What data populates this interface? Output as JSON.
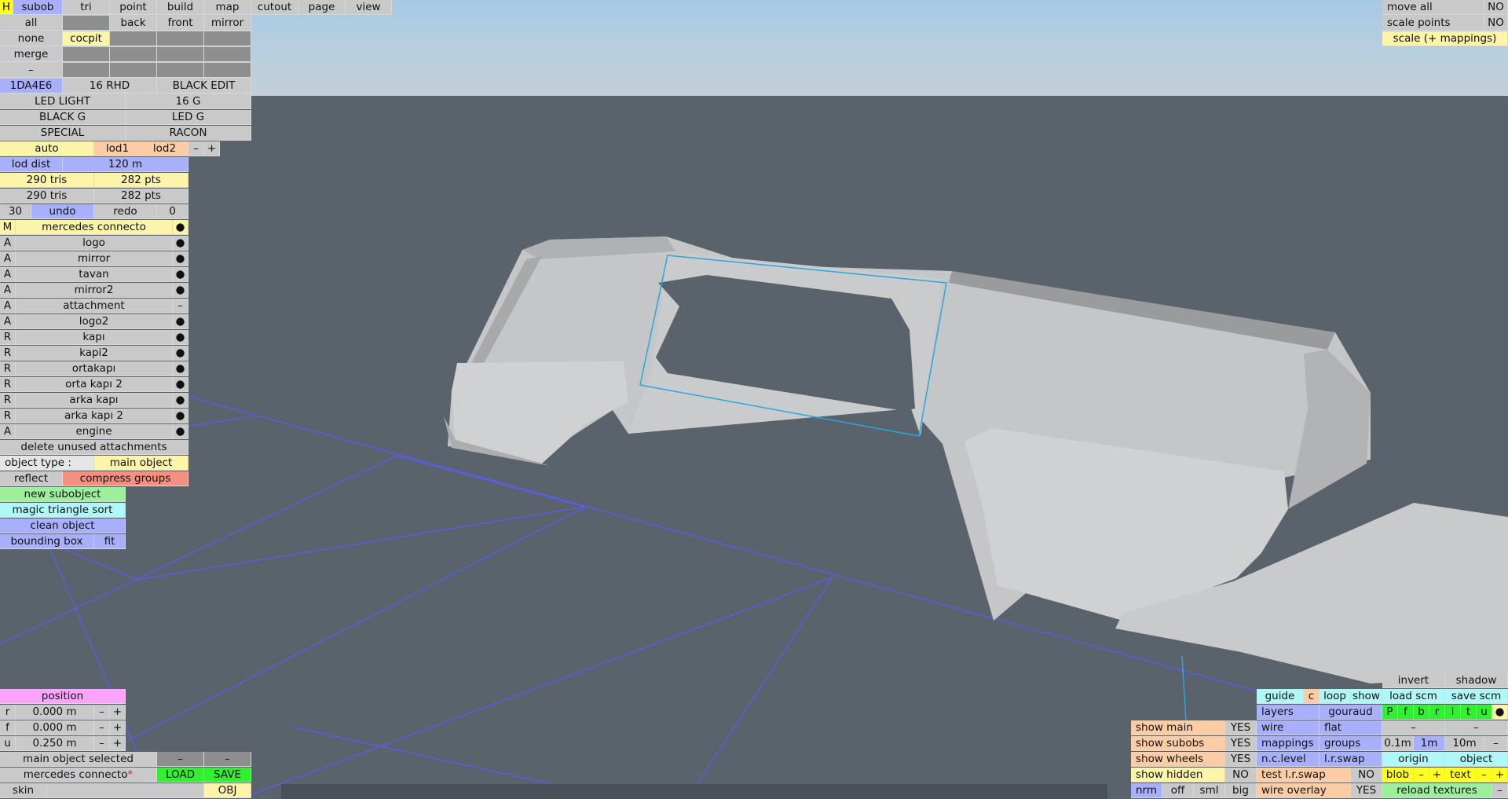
{
  "colors": {
    "sky_top": "#a7c9e4",
    "floor": "#5a626b",
    "grid": "#5a5cf0",
    "selection": "#2aa6e0",
    "model": "#c4c5c6"
  },
  "top_menu": {
    "h": "H",
    "items": [
      "subob",
      "tri",
      "point",
      "build",
      "map",
      "cutout",
      "page",
      "view"
    ]
  },
  "view_rows": {
    "all": "all",
    "back": "back",
    "front": "front",
    "mirror": "mirror",
    "none": "none",
    "cocpit": "cocpit",
    "merge": "merge",
    "dash": "–"
  },
  "mat_buttons": {
    "a": "1DA4E6",
    "b": "16 RHD",
    "c": "BLACK EDIT",
    "d": "LED LIGHT",
    "e": "16 G",
    "f": "BLACK G",
    "g": "LED G",
    "h": "SPECIAL",
    "i": "RACON"
  },
  "lod": {
    "auto": "auto",
    "lod1": "lod1",
    "lod2": "lod2",
    "minus": "–",
    "plus": "+",
    "dist_label": "lod dist",
    "dist_value": "120 m"
  },
  "stats": {
    "tris1": "290 tris",
    "pts1": "282 pts",
    "tris2": "290 tris",
    "pts2": "282 pts"
  },
  "undo": {
    "count": "30",
    "undo": "undo",
    "redo": "redo",
    "redo_count": "0"
  },
  "objects": {
    "root": {
      "tag": "M",
      "name": "mercedes connecto",
      "dot": "●"
    },
    "items": [
      {
        "tag": "A",
        "name": "logo",
        "dot": "●"
      },
      {
        "tag": "A",
        "name": "mirror",
        "dot": "●"
      },
      {
        "tag": "A",
        "name": "tavan",
        "dot": "●"
      },
      {
        "tag": "A",
        "name": "mirror2",
        "dot": "●"
      },
      {
        "tag": "A",
        "name": "attachment",
        "dot": "–"
      },
      {
        "tag": "A",
        "name": "logo2",
        "dot": "●"
      },
      {
        "tag": "R",
        "name": "kapı",
        "dot": "●"
      },
      {
        "tag": "R",
        "name": "kapi2",
        "dot": "●"
      },
      {
        "tag": "R",
        "name": "ortakapı",
        "dot": "●"
      },
      {
        "tag": "R",
        "name": "orta kapı 2",
        "dot": "●"
      },
      {
        "tag": "R",
        "name": "arka kapı",
        "dot": "●"
      },
      {
        "tag": "R",
        "name": "arka kapı 2",
        "dot": "●"
      },
      {
        "tag": "A",
        "name": "engine",
        "dot": "●"
      }
    ]
  },
  "actions": {
    "delete_unused": "delete unused attachments",
    "object_type_label": "object type :",
    "object_type_value": "main object",
    "reflect": "reflect",
    "compress": "compress groups",
    "new_subobject": "new subobject",
    "magic_sort": "magic triangle sort",
    "clean": "clean object",
    "bbox": "bounding box",
    "fit": "fit"
  },
  "position": {
    "title": "position",
    "rows": [
      {
        "axis": "r",
        "value": "0.000 m"
      },
      {
        "axis": "f",
        "value": "0.000 m"
      },
      {
        "axis": "u",
        "value": "0.250 m"
      }
    ],
    "minus": "–",
    "plus": "+"
  },
  "status": {
    "selected": "main object selected",
    "dash": "–",
    "file": "mercedes connecto",
    "asterisk": "*",
    "load": "LOAD",
    "save": "SAVE",
    "skin": "skin",
    "obj": "OBJ"
  },
  "top_right": {
    "move_all": "move all",
    "move_val": "NO",
    "scale_points": "scale points",
    "scale_val": "NO",
    "scale_map": "scale (+ mappings)"
  },
  "show_panel": {
    "rows": [
      {
        "label": "show main",
        "value": "YES"
      },
      {
        "label": "show subobs",
        "value": "YES"
      },
      {
        "label": "show wheels",
        "value": "YES"
      },
      {
        "label": "show hidden",
        "value": "NO"
      }
    ],
    "nrm": "nrm",
    "off": "off",
    "sml": "sml",
    "big": "big"
  },
  "right_panel": {
    "invert": "invert",
    "shadow": "shadow",
    "guide": "guide",
    "c": "c",
    "loop": "loop",
    "show": "show",
    "load_scm": "load scm",
    "save_scm": "save scm",
    "layers": "layers",
    "gouraud": "gouraud",
    "layer_letters": [
      "P",
      "f",
      "b",
      "r",
      "l",
      "t",
      "u"
    ],
    "dot": "●",
    "wire": "wire",
    "flat": "flat",
    "dash": "–",
    "mappings": "mappings",
    "groups": "groups",
    "d01": "0.1m",
    "d1": "1m",
    "d10": "10m",
    "nclevel": "n.c.level",
    "lrswap": "l.r.swap",
    "origin": "origin",
    "object": "object",
    "test_lrswap": "test l.r.swap",
    "test_val": "NO",
    "blob": "blob",
    "text": "text",
    "minus": "–",
    "plus": "+",
    "wire_overlay": "wire overlay",
    "wire_overlay_val": "YES",
    "reload_textures": "reload textures"
  }
}
